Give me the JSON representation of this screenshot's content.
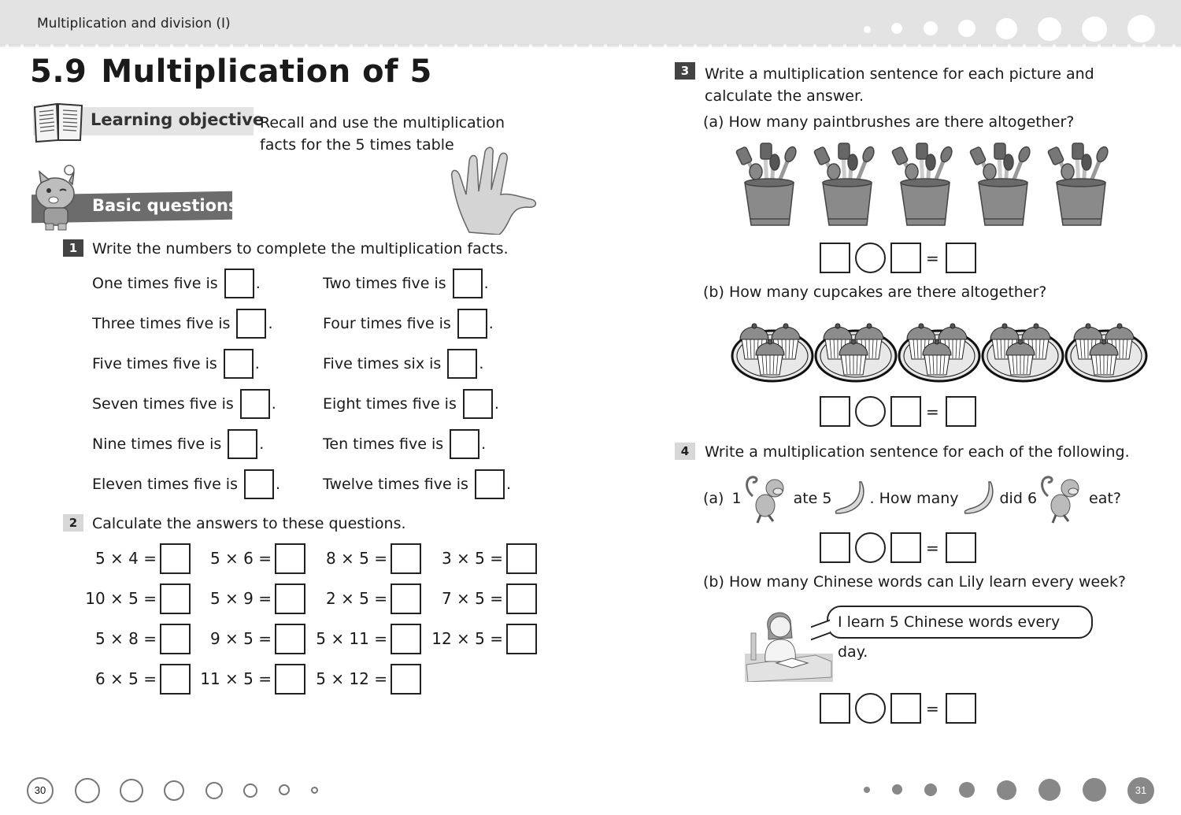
{
  "header": {
    "chapter": "Multiplication and division (I)"
  },
  "title": {
    "number": "5.9",
    "text": "Multiplication of 5"
  },
  "learning_objective": {
    "label": "Learning objective",
    "text": "Recall and use the multiplication facts for the 5 times table"
  },
  "basic_questions": {
    "label": "Basic questions"
  },
  "q1": {
    "number": "1",
    "instruction": "Write the numbers to complete the multiplication facts.",
    "facts_left": [
      "One times five is",
      "Three times five is",
      "Five times five is",
      "Seven times five is",
      "Nine times five is",
      "Eleven times five is"
    ],
    "facts_right": [
      "Two times five is",
      "Four times five is",
      "Five times six is",
      "Eight times five is",
      "Ten times five is",
      "Twelve times five is"
    ],
    "period": "."
  },
  "q2": {
    "number": "2",
    "instruction": "Calculate the answers to these questions.",
    "rows": [
      [
        "5 × 4 =",
        "5 × 6 =",
        "8 × 5 =",
        "3 × 5 ="
      ],
      [
        "10 × 5 =",
        "5 × 9 =",
        "2 × 5 =",
        "7 × 5 ="
      ],
      [
        "5 × 8 =",
        "9 × 5 =",
        "5 × 11 =",
        "12 × 5 ="
      ],
      [
        "6 × 5 =",
        "11 × 5 =",
        "5 × 12 ="
      ]
    ]
  },
  "q3": {
    "number": "3",
    "instruction": "Write a multiplication sentence for each picture and calculate the answer.",
    "a": {
      "label": "(a)",
      "question": "How many paintbrushes are there altogether?",
      "picture_count": 5,
      "picture": "paintbrush-cup"
    },
    "b": {
      "label": "(b)",
      "question": "How many cupcakes are there altogether?",
      "picture_count": 5,
      "picture": "cupcake-plate"
    },
    "equals": "="
  },
  "q4": {
    "number": "4",
    "instruction": "Write a multiplication sentence for each of the following.",
    "a": {
      "label": "(a)",
      "parts": [
        "1",
        "ate 5",
        ". How many",
        "did 6",
        "eat?"
      ]
    },
    "b": {
      "label": "(b)",
      "question": "How many Chinese words can Lily learn every week?",
      "speech": "I learn 5 Chinese words every day."
    },
    "equals": "="
  },
  "footer": {
    "page_left": "30",
    "page_right": "31"
  }
}
